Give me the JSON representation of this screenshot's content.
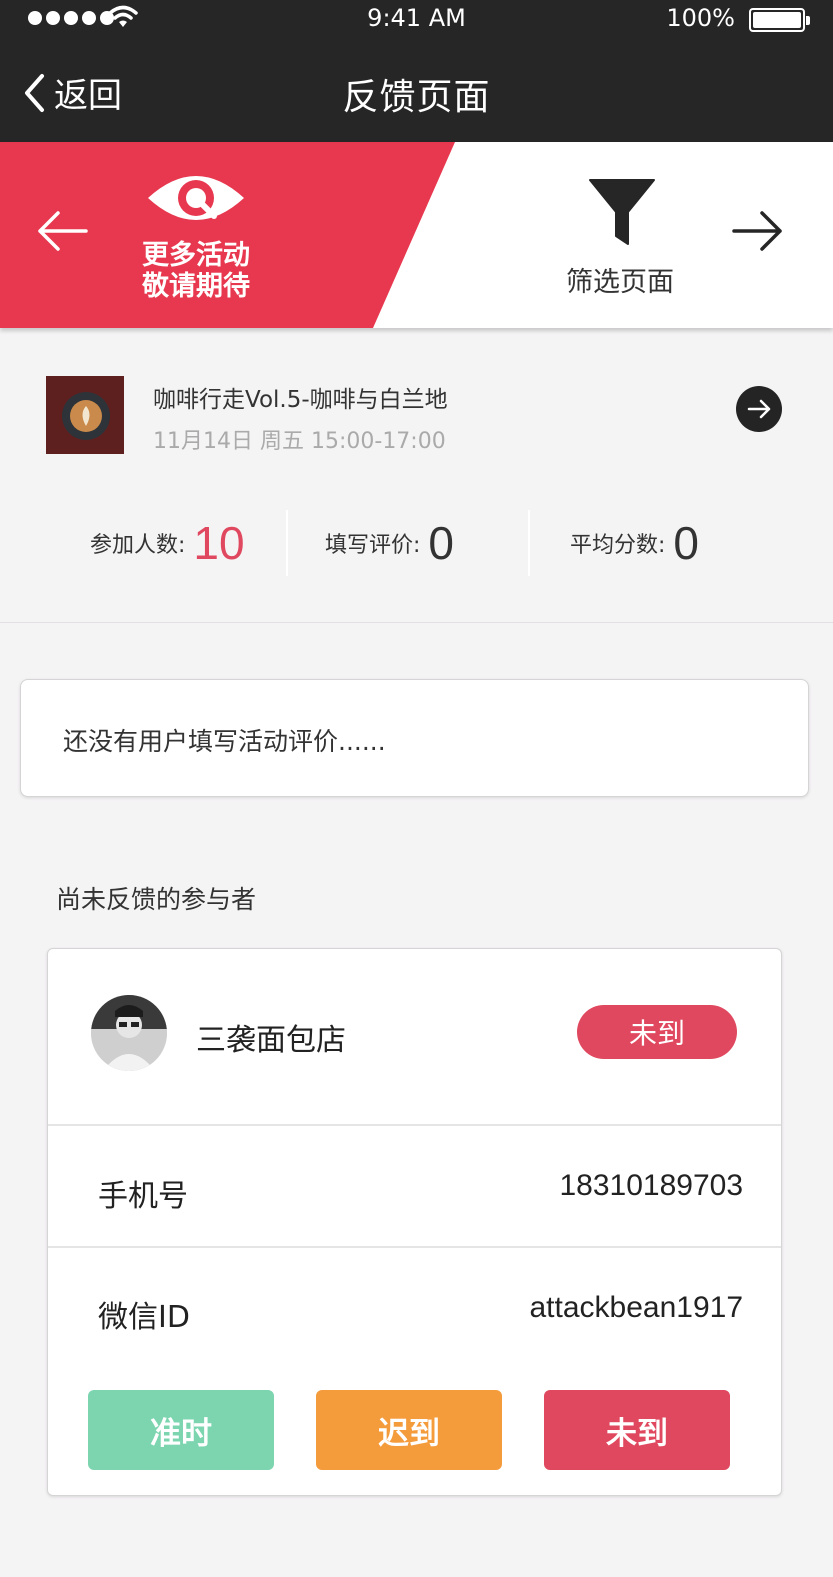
{
  "status_bar": {
    "time": "9:41 AM",
    "battery": "100%"
  },
  "nav": {
    "back_label": "返回",
    "title": "反馈页面"
  },
  "banner": {
    "left_line1": "更多活动",
    "left_line2": "敬请期待",
    "right_label": "筛选页面",
    "accent_color": "#e8384f"
  },
  "event": {
    "title": "咖啡行走Vol.5-咖啡与白兰地",
    "time": "11月14日 周五 15:00-17:00"
  },
  "stats": [
    {
      "label": "参加人数:",
      "value": "10"
    },
    {
      "label": "填写评价:",
      "value": "0"
    },
    {
      "label": "平均分数:",
      "value": "0"
    }
  ],
  "empty_message": "还没有用户填写活动评价......",
  "section_title": "尚未反馈的参与者",
  "participant": {
    "name": "三袭面包店",
    "status": "未到",
    "phone_label": "手机号",
    "phone": "18310189703",
    "wechat_label": "微信ID",
    "wechat": "attackbean1917"
  },
  "actions": {
    "on_time": "准时",
    "late": "迟到",
    "absent": "未到",
    "colors": {
      "on_time": "#7dd5b0",
      "late": "#f49b3c",
      "absent": "#e0485f"
    }
  }
}
